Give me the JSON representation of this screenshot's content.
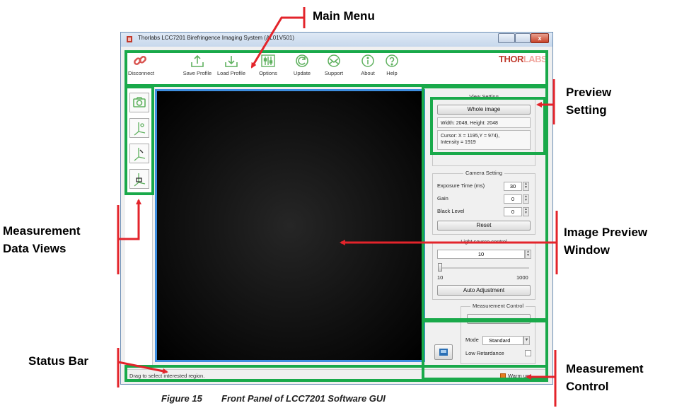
{
  "window": {
    "title": "Thorlabs LCC7201 Birefringence Imaging System (AL01V501)",
    "close_glyph": "x"
  },
  "toolbar": {
    "items": [
      {
        "label": "Disconnect",
        "icon": "disconnect-icon"
      },
      {
        "label": "Save Profile",
        "icon": "save-profile-icon"
      },
      {
        "label": "Load Profile",
        "icon": "load-profile-icon"
      },
      {
        "label": "Options",
        "icon": "options-icon"
      },
      {
        "label": "Update",
        "icon": "update-icon"
      },
      {
        "label": "Support",
        "icon": "support-icon"
      },
      {
        "label": "About",
        "icon": "about-icon"
      },
      {
        "label": "Help",
        "icon": "help-icon"
      }
    ],
    "logo": "THORLABS"
  },
  "view_setting": {
    "title": "View Setting",
    "button": "Whole image",
    "size_text": "Width: 2048, Height: 2048",
    "cursor_text": "Cursor: X = 1195,Y = 974),",
    "intensity_text": "Intensity = 1919"
  },
  "camera_setting": {
    "title": "Camera Setting",
    "exposure_label": "Exposure Time (ms)",
    "exposure_value": "30",
    "gain_label": "Gain",
    "gain_value": "0",
    "black_label": "Black Level",
    "black_value": "0",
    "reset_button": "Reset"
  },
  "light_source": {
    "title": "Light source control",
    "value": "10",
    "min_label": "10",
    "max_label": "1000",
    "auto_button": "Auto Adjustment"
  },
  "measurement_control": {
    "title": "Measurement Control",
    "mode_label": "Mode",
    "mode_value": "Standard",
    "low_retardance_label": "Low Retardance"
  },
  "status_bar": {
    "text": "Drag to select interested region.",
    "warm_up": "Warm up"
  },
  "callouts": {
    "main_menu": "Main Menu",
    "preview_setting_1": "Preview",
    "preview_setting_2": "Setting",
    "measurement_views_1": "Measurement",
    "measurement_views_2": "Data Views",
    "image_preview_1": "Image Preview",
    "image_preview_2": "Window",
    "status_bar": "Status Bar",
    "measurement_control_1": "Measurement",
    "measurement_control_2": "Control"
  },
  "caption": {
    "figure": "Figure 15",
    "text": "Front Panel of LCC7201 Software GUI"
  },
  "colors": {
    "annotation_green": "#19a94a",
    "arrow_red": "#e3242b",
    "preview_border": "#3d8ee0"
  }
}
